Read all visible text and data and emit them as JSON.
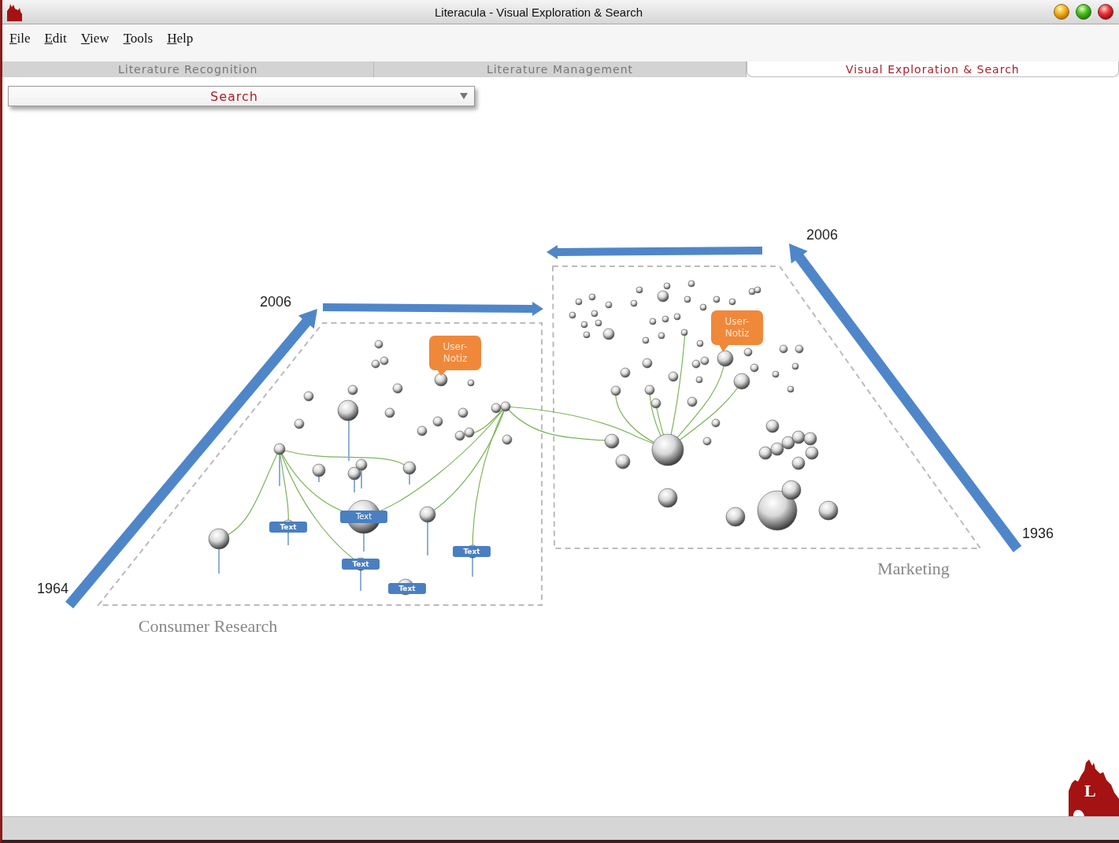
{
  "window": {
    "title": "Literacula - Visual Exploration & Search"
  },
  "menu": [
    {
      "label": "File"
    },
    {
      "label": "Edit"
    },
    {
      "label": "View"
    },
    {
      "label": "Tools"
    },
    {
      "label": "Help"
    }
  ],
  "tabs": [
    {
      "label": "Literature Recognition",
      "selected": false
    },
    {
      "label": "Literature Management",
      "selected": false
    },
    {
      "label": "Visual Exploration & Search",
      "selected": true
    }
  ],
  "search_dropdown": {
    "value": "Search"
  },
  "visualization": {
    "clusters": [
      {
        "name": "Consumer Research",
        "year_start": "1964",
        "year_end": "2006",
        "notes": [
          "User-Notiz"
        ],
        "tags": [
          "Text",
          "Text",
          "Text",
          "Text",
          "Text"
        ]
      },
      {
        "name": "Marketing",
        "year_start": "1936",
        "year_end": "2006",
        "notes": [
          "User-Notiz"
        ]
      }
    ]
  },
  "logo": {
    "letter": "L"
  }
}
